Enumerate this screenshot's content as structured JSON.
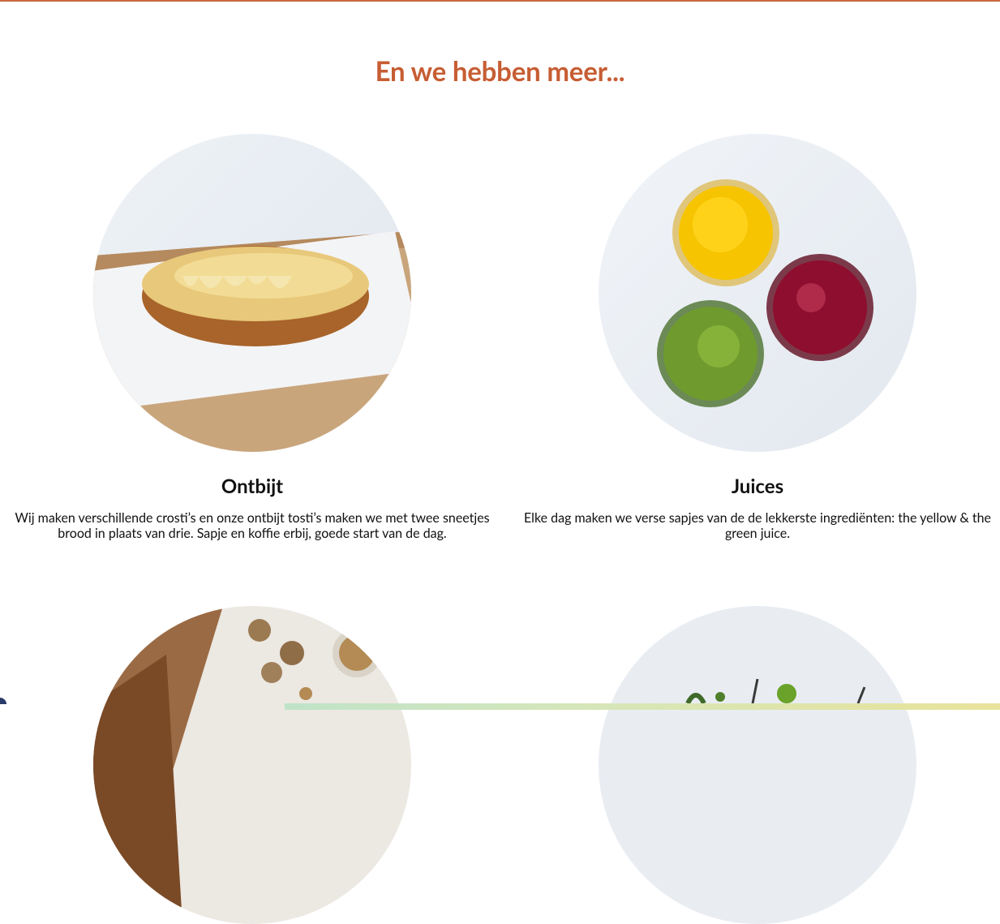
{
  "section": {
    "title": "En we hebben meer..."
  },
  "cards": [
    {
      "title": "Ontbijt",
      "text": "Wij maken verschillende crosti’s en onze ontbijt tosti’s maken we met twee sneetjes brood in plaats van drie. Sapje en koffie erbij, goede start van de dag.",
      "image": "croissant-tosti-photo"
    },
    {
      "title": "Juices",
      "text": "Elke dag maken we verse sapjes van de de lekkerste ingrediënten: the yellow & the green juice.",
      "image": "juices-photo"
    }
  ],
  "colors": {
    "accent": "#c75d33",
    "text": "#111111"
  }
}
